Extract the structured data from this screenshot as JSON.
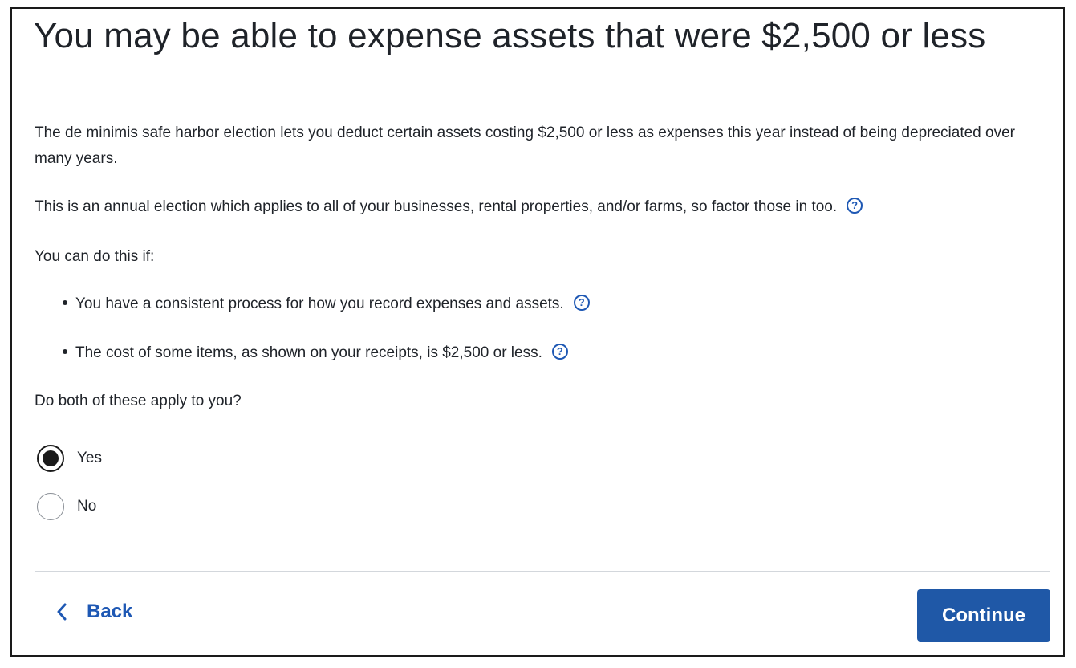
{
  "page": {
    "title": "You may be able to expense assets that were $2,500 or less",
    "intro": "The de minimis safe harbor election lets you deduct certain assets costing $2,500 or less as expenses this year instead of being depreciated over many years.",
    "annual_note": "This is an annual election which applies to all of your businesses, rental properties, and/or farms, so factor those in too.",
    "conditions_lead": "You can do this if:",
    "conditions": [
      "You have a consistent process for how you record expenses and assets.",
      "The cost of some items, as shown on your receipts, is $2,500 or less."
    ],
    "question": "Do both of these apply to you?"
  },
  "options": [
    {
      "label": "Yes",
      "selected": true
    },
    {
      "label": "No",
      "selected": false
    }
  ],
  "footer": {
    "back_label": "Back",
    "continue_label": "Continue"
  },
  "icons": {
    "help": "help-question-icon",
    "back": "chevron-left-icon"
  },
  "colors": {
    "accent": "#1e58b4",
    "button_bg": "#1f58a7",
    "text": "#1f2329"
  }
}
